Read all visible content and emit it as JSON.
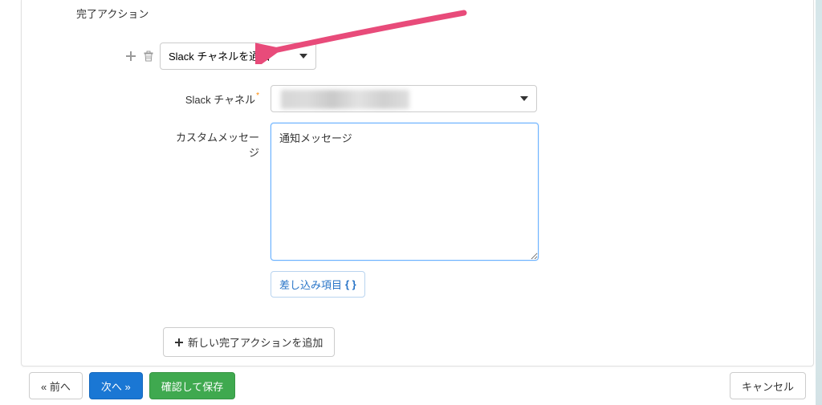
{
  "section": {
    "title": "完了アクション"
  },
  "action": {
    "selected_label": "Slack チャネルを通知"
  },
  "fields": {
    "channel_label": "Slack チャネル",
    "channel_value": "",
    "message_label": "カスタムメッセージ",
    "message_value": "通知メッセージ",
    "merge_button_label": "差し込み項目",
    "merge_button_braces": "{ }"
  },
  "buttons": {
    "add_action": "新しい完了アクションを追加",
    "prev": "« 前へ",
    "next": "次へ »",
    "confirm_save": "確認して保存",
    "cancel": "キャンセル"
  },
  "icons": {
    "plus": "plus-icon",
    "trash": "trash-icon"
  }
}
